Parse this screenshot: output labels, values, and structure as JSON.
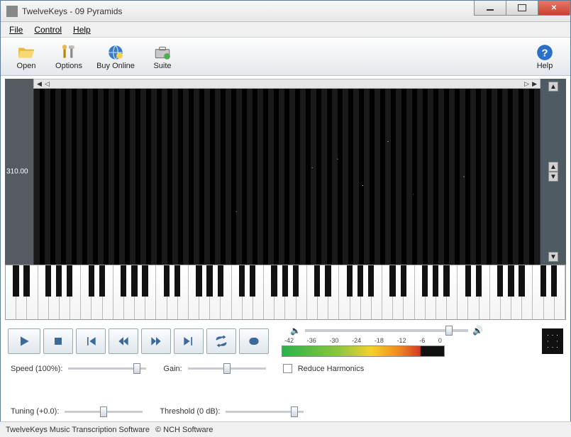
{
  "title": "TwelveKeys - 09 Pyramids",
  "menu": {
    "file": "File",
    "control": "Control",
    "help": "Help"
  },
  "toolbar": {
    "open": "Open",
    "options": "Options",
    "buy": "Buy Online",
    "suite": "Suite",
    "help": "Help"
  },
  "left_gutter": {
    "freq": "310.00"
  },
  "transport": {
    "volume_ticks": [
      "-42",
      "-36",
      "-30",
      "-24",
      "-18",
      "-12",
      "-6",
      "0"
    ]
  },
  "controls": {
    "speed_label": "Speed (100%):",
    "gain_label": "Gain:",
    "tuning_label": "Tuning (+0.0):",
    "threshold_label": "Threshold (0 dB):",
    "reduce_harmonics": "Reduce Harmonics"
  },
  "status": {
    "app": "TwelveKeys Music Transcription Software",
    "copyright": "© NCH Software"
  }
}
